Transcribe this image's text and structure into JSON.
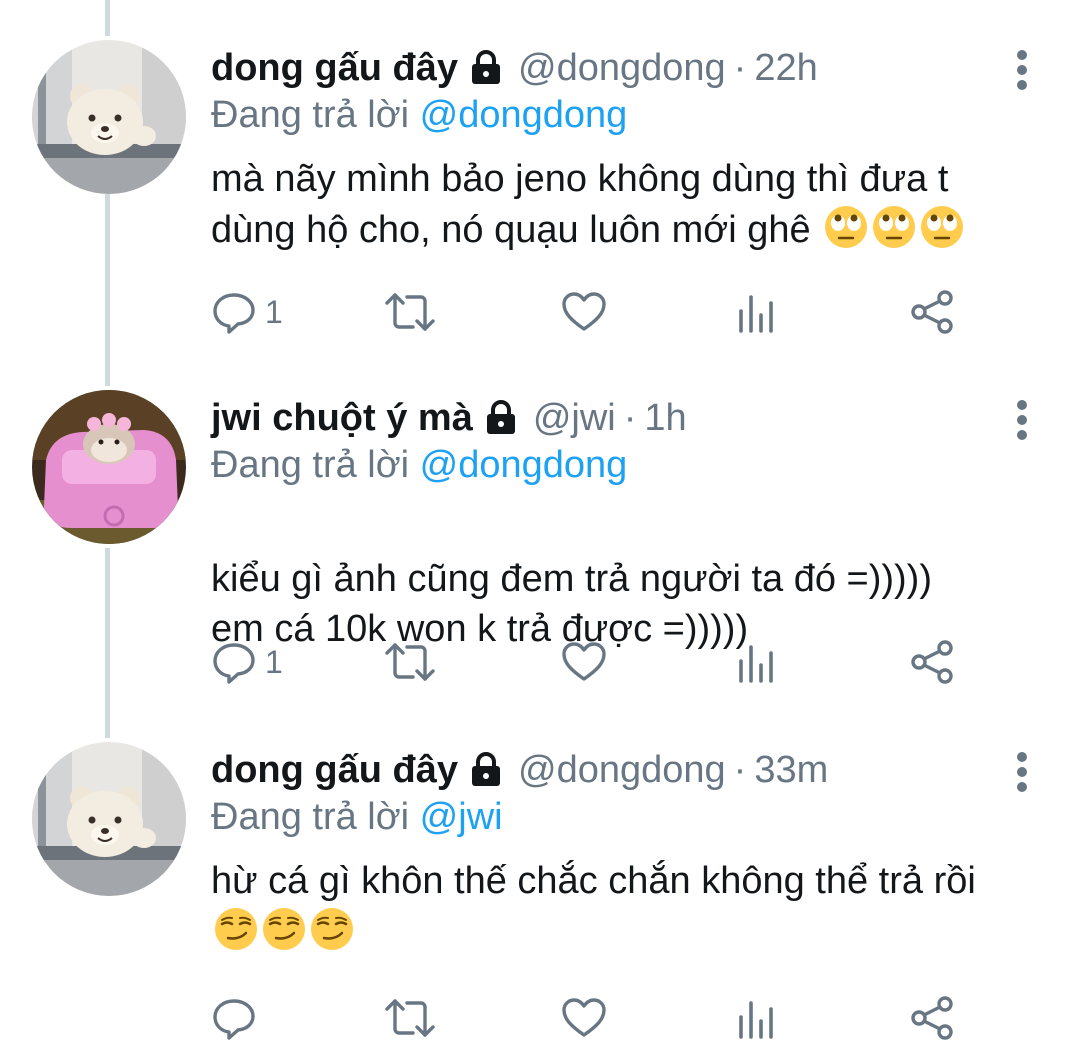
{
  "colors": {
    "name": "#14171a",
    "secondary": "#687684",
    "mention": "#1da1f2",
    "thread_line": "#cfd9de",
    "icon": "#687684"
  },
  "icons": [
    "lock-icon",
    "more-icon",
    "reply-icon",
    "retweet-icon",
    "like-icon",
    "stats-icon",
    "share-icon"
  ],
  "tweets": [
    {
      "name": "dong gấu đây",
      "handle": "@dongdong",
      "dot": "·",
      "time": "22h",
      "reply_prefix": "Đang trả lời ",
      "reply_to": "@dongdong",
      "text": "mà nãy mình bảo jeno không dùng thì đưa t dùng hộ cho, nó quạu luôn mới ghê",
      "emoji": "face-with-rolling-eyes",
      "emoji_count": 3,
      "reply_count": "1"
    },
    {
      "name": "jwi chuột ý mà",
      "handle": "@jwi",
      "dot": "·",
      "time": "1h",
      "reply_prefix": "Đang trả lời ",
      "reply_to": "@dongdong",
      "text": "kiểu gì ảnh cũng đem trả người ta đó =)))))\nem cá 10k won k trả được =)))))",
      "reply_count": "1"
    },
    {
      "name": "dong gấu đây",
      "handle": "@dongdong",
      "dot": "·",
      "time": "33m",
      "reply_prefix": "Đang trả lời ",
      "reply_to": "@jwi",
      "text": "hừ cá gì khôn thế chắc chắn không thể trả rồi",
      "emoji": "smirking-face",
      "emoji_count": 3,
      "reply_count": ""
    }
  ]
}
